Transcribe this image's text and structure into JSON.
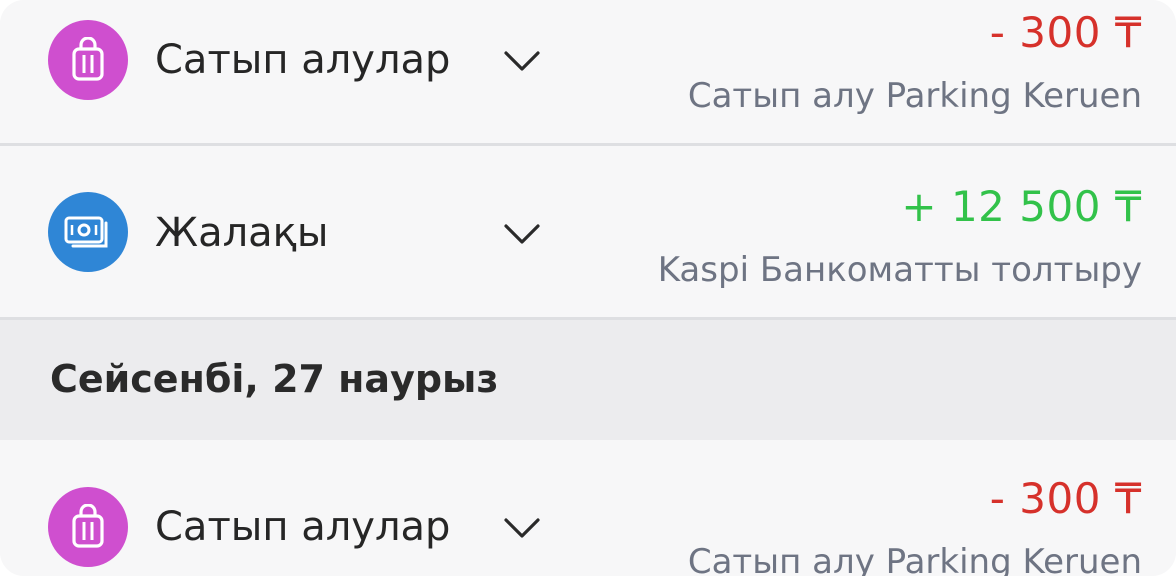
{
  "transactions_top": [
    {
      "category": "Сатып алулар",
      "icon": "shopping-bag-icon",
      "icon_color": "#cf4fcf",
      "amount": "-  300 ₸",
      "amount_color": "#d6312b",
      "description": "Сатып алу Parking Keruen"
    },
    {
      "category": "Жалақы",
      "icon": "banknotes-icon",
      "icon_color": "#2f86d6",
      "amount": "+ 12 500 ₸",
      "amount_color": "#32c24a",
      "description": "Kaspi Банкоматты толтыру"
    }
  ],
  "date_header": "Сейсенбі, 27 наурыз",
  "transactions_bottom": [
    {
      "category": "Сатып алулар",
      "icon": "shopping-bag-icon",
      "icon_color": "#cf4fcf",
      "amount": "-  300 ₸",
      "amount_color": "#d6312b",
      "description": "Сатып алу Parking Keruen"
    }
  ]
}
